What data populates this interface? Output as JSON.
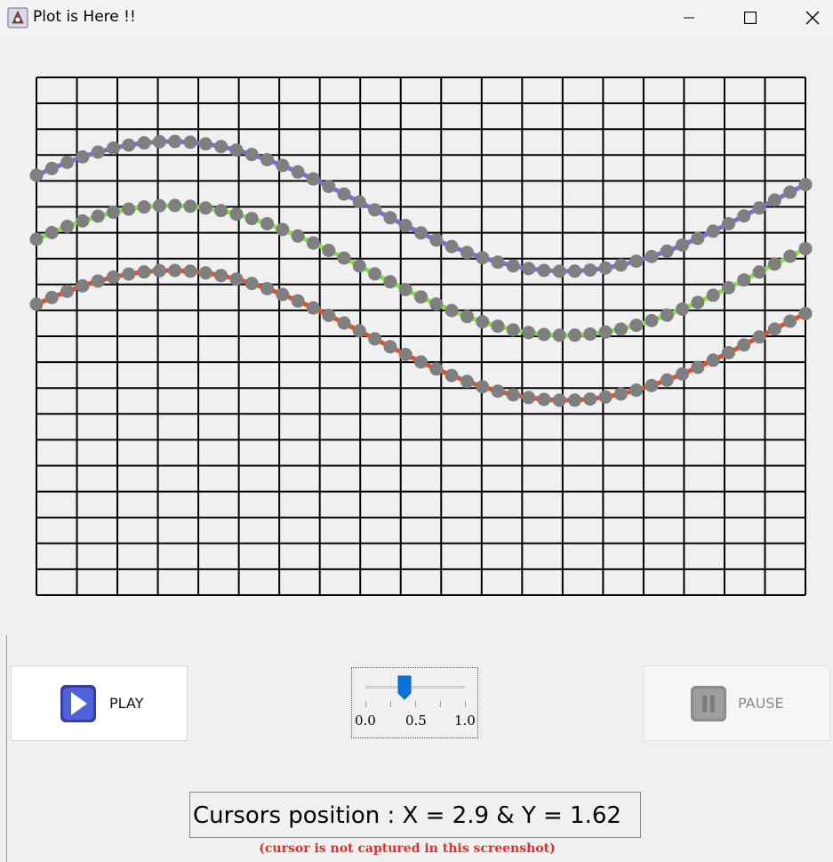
{
  "window": {
    "title": "Plot is Here !!",
    "icons": {
      "app": "java-app-icon",
      "minimize": "minimize-icon",
      "maximize": "maximize-icon",
      "close": "close-icon"
    }
  },
  "plot": {
    "grid_visible": true,
    "grid_columns": 19,
    "grid_rows": 20,
    "curves": [
      {
        "color": "#6f6ff2",
        "marker_color": "#7f7f7f"
      },
      {
        "color": "#7ee83a",
        "marker_color": "#7f7f7f"
      },
      {
        "color": "#f04a1f",
        "marker_color": "#7f7f7f"
      }
    ]
  },
  "controls": {
    "play_label": "PLAY",
    "play_icon": "play-icon",
    "pause_label": "PAUSE",
    "pause_icon": "pause-icon",
    "pause_enabled": false,
    "slider": {
      "value": 0.4,
      "min_label": "0.0",
      "mid_label": "0.5",
      "max_label": "1.0"
    }
  },
  "cursor": {
    "text": "Cursors position : X = 2.9 & Y = 1.62",
    "note": "(cursor is not captured in this screenshot)"
  }
}
